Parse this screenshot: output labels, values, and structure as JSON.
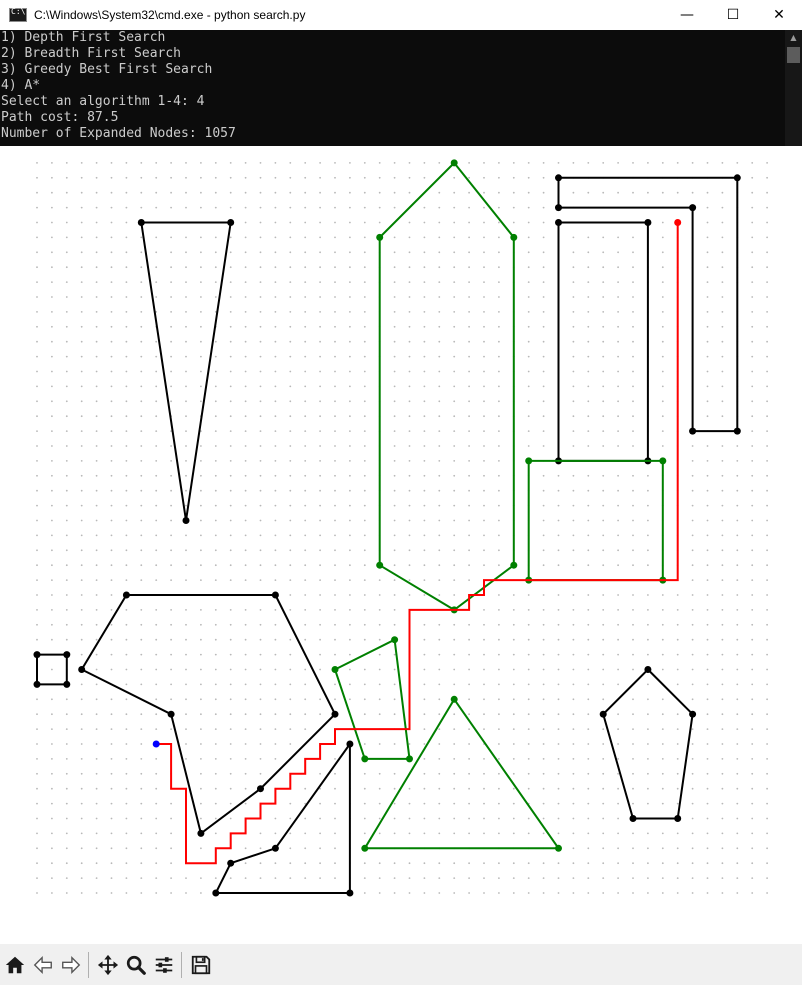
{
  "window": {
    "title": "C:\\Windows\\System32\\cmd.exe - python  search.py",
    "controls": {
      "minimize": "—",
      "maximize": "☐",
      "close": "✕"
    }
  },
  "console": {
    "lines": [
      "1) Depth First Search",
      "2) Breadth First Search",
      "3) Greedy Best First Search",
      "4) A*",
      "Select an algorithm 1-4: 4",
      "Path cost: 87.5",
      "Number of Expanded Nodes: 1057"
    ]
  },
  "toolbar": {
    "buttons": [
      {
        "name": "home-button",
        "icon": "home-icon"
      },
      {
        "name": "back-button",
        "icon": "arrow-left-icon"
      },
      {
        "name": "forward-button",
        "icon": "arrow-right-icon"
      },
      {
        "name": "pan-button",
        "icon": "move-icon"
      },
      {
        "name": "zoom-button",
        "icon": "magnifier-icon"
      },
      {
        "name": "configure-subplots-button",
        "icon": "sliders-icon"
      },
      {
        "name": "save-button",
        "icon": "floppy-disk-icon"
      }
    ]
  },
  "chart_data": {
    "type": "scatter",
    "title": "",
    "xlabel": "",
    "ylabel": "",
    "grid": "dotted grid of points every 1 unit",
    "xlim": [
      0,
      49
    ],
    "ylim": [
      0,
      49
    ],
    "colors": {
      "obstacle_black": "#000000",
      "obstacle_green": "#008000",
      "path": "#ff0000",
      "start": "#0000ff",
      "goal": "#ff0000"
    },
    "start": [
      8,
      10
    ],
    "goal": [
      43,
      45
    ],
    "path_cost": 87.5,
    "expanded_nodes": 1057,
    "obstacles": [
      {
        "color": "black",
        "points": [
          [
            7,
            45
          ],
          [
            13,
            45
          ],
          [
            10,
            25
          ]
        ]
      },
      {
        "color": "green",
        "points": [
          [
            23,
            44
          ],
          [
            28,
            49
          ],
          [
            32,
            44
          ],
          [
            32,
            22
          ],
          [
            28,
            19
          ],
          [
            23,
            22
          ]
        ]
      },
      {
        "color": "black",
        "points": [
          [
            35,
            48
          ],
          [
            47,
            48
          ],
          [
            47,
            31
          ],
          [
            44,
            31
          ],
          [
            44,
            46
          ],
          [
            35,
            46
          ]
        ]
      },
      {
        "color": "black",
        "points": [
          [
            35,
            45
          ],
          [
            41,
            45
          ],
          [
            41,
            29
          ],
          [
            35,
            29
          ]
        ]
      },
      {
        "color": "green",
        "points": [
          [
            33,
            29
          ],
          [
            42,
            29
          ],
          [
            42,
            21
          ],
          [
            33,
            21
          ]
        ]
      },
      {
        "color": "black",
        "points": [
          [
            6,
            20
          ],
          [
            16,
            20
          ],
          [
            20,
            12
          ],
          [
            15,
            7
          ],
          [
            11,
            4
          ],
          [
            9,
            12
          ],
          [
            3,
            15
          ]
        ]
      },
      {
        "color": "black",
        "points": [
          [
            0,
            16
          ],
          [
            2,
            16
          ],
          [
            2,
            14
          ],
          [
            0,
            14
          ]
        ]
      },
      {
        "color": "green",
        "points": [
          [
            20,
            15
          ],
          [
            24,
            17
          ],
          [
            25,
            9
          ],
          [
            22,
            9
          ]
        ]
      },
      {
        "color": "black",
        "points": [
          [
            21,
            10
          ],
          [
            16,
            3
          ],
          [
            13,
            2
          ],
          [
            12,
            0
          ],
          [
            21,
            0
          ]
        ]
      },
      {
        "color": "green",
        "points": [
          [
            28,
            13
          ],
          [
            35,
            3
          ],
          [
            22,
            3
          ]
        ]
      },
      {
        "color": "black",
        "points": [
          [
            41,
            15
          ],
          [
            44,
            12
          ],
          [
            43,
            5
          ],
          [
            40,
            5
          ],
          [
            38,
            12
          ]
        ]
      }
    ],
    "path": [
      [
        43,
        45
      ],
      [
        43,
        21
      ],
      [
        30,
        21
      ],
      [
        30,
        20
      ],
      [
        29,
        20
      ],
      [
        29,
        19
      ],
      [
        25,
        19
      ],
      [
        25,
        11
      ],
      [
        20,
        11
      ],
      [
        20,
        10
      ],
      [
        19,
        10
      ],
      [
        19,
        9
      ],
      [
        18,
        9
      ],
      [
        18,
        8
      ],
      [
        17,
        8
      ],
      [
        17,
        7
      ],
      [
        16,
        7
      ],
      [
        16,
        6
      ],
      [
        15,
        6
      ],
      [
        15,
        5
      ],
      [
        14,
        5
      ],
      [
        14,
        4
      ],
      [
        13,
        4
      ],
      [
        13,
        3
      ],
      [
        12,
        3
      ],
      [
        12,
        2
      ],
      [
        10,
        2
      ],
      [
        10,
        7
      ],
      [
        9,
        7
      ],
      [
        9,
        10
      ],
      [
        8,
        10
      ]
    ]
  }
}
